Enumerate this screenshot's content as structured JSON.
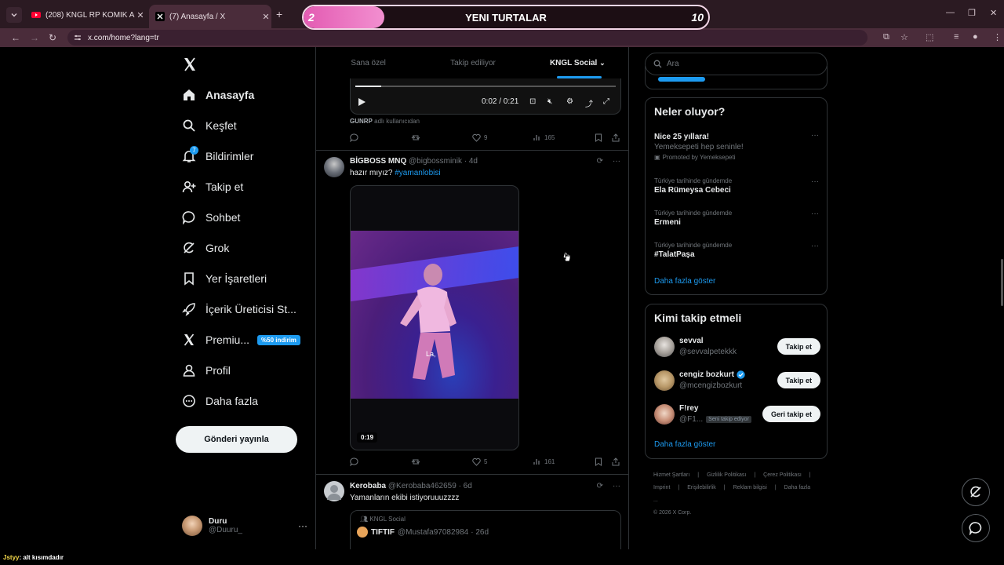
{
  "browser": {
    "tabs": [
      {
        "title": "(208) KNGL RP KOMİK ANLAR #",
        "icon": "youtube-icon"
      },
      {
        "title": "(7) Anasayfa / X",
        "icon": "x-icon"
      }
    ],
    "url": "x.com/home?lang=tr"
  },
  "overlay": {
    "left_value": "2",
    "title": "YENI TURTALAR",
    "right_value": "10",
    "progress": 0.2
  },
  "nav": {
    "items": [
      {
        "label": "Anasayfa",
        "icon": "home-icon"
      },
      {
        "label": "Keşfet",
        "icon": "search-icon"
      },
      {
        "label": "Bildirimler",
        "icon": "bell-icon",
        "badge": "7"
      },
      {
        "label": "Takip et",
        "icon": "follow-icon"
      },
      {
        "label": "Sohbet",
        "icon": "chat-icon"
      },
      {
        "label": "Grok",
        "icon": "grok-icon"
      },
      {
        "label": "Yer İşaretleri",
        "icon": "bookmark-icon"
      },
      {
        "label": "İçerik Üreticisi St...",
        "icon": "rocket-icon"
      },
      {
        "label": "Premiu...",
        "icon": "x-icon",
        "promo": "%50 indirim"
      },
      {
        "label": "Profil",
        "icon": "profile-icon"
      },
      {
        "label": "Daha fazla",
        "icon": "more-circle-icon"
      }
    ],
    "post_button": "Gönderi yayınla",
    "account": {
      "name": "Duru",
      "handle": "@Duuru_"
    }
  },
  "feed": {
    "tabs": [
      "Sana özel",
      "Takip ediliyor",
      "KNGL Social"
    ],
    "video_player": {
      "time": "0:02 / 0:21",
      "progress": 0.1
    },
    "source": {
      "user": "GUNRP",
      "text": "adlı kullanıcıdan"
    },
    "post1_actions": {
      "retweets": "",
      "likes": "9",
      "views": "165"
    },
    "post2": {
      "name": "BİGBOSS MNQ",
      "handle": "@bigbossminik",
      "time": "· 4d",
      "text": "hazır mıyız?",
      "hashtag": "#yamanlobisi",
      "caption": "La,",
      "duration": "0:19",
      "likes": "5",
      "views": "161"
    },
    "post3": {
      "name": "Kerobaba",
      "handle": "@Kerobaba462659",
      "time": "· 6d",
      "text": "Yamanların ekibi istiyoruuuzzzz",
      "quote": {
        "context": "KNGL Social",
        "name": "TIFTIF",
        "handle": "@Mustafa97082984",
        "time": "· 26d"
      }
    }
  },
  "right": {
    "search_placeholder": "Ara",
    "trends_title": "Neler oluyor?",
    "trends": [
      {
        "title": "Nice 25 yıllara!",
        "sub": "Yemeksepeti hep seninle!",
        "promo": "Promoted by Yemeksepeti"
      },
      {
        "context": "Türkiye tarihinde gündemde",
        "title": "Ela Rümeysa Cebeci"
      },
      {
        "context": "Türkiye tarihinde gündemde",
        "title": "Ermeni"
      },
      {
        "context": "Türkiye tarihinde gündemde",
        "title": "#TalatPaşa"
      }
    ],
    "show_more": "Daha fazla göster",
    "who_title": "Kimi takip etmeli",
    "who": [
      {
        "name": "sevval",
        "handle": "@sevvalpetekkk",
        "button": "Takip et"
      },
      {
        "name": "cengiz bozkurt",
        "handle": "@mcengizbozkurt",
        "button": "Takip et",
        "verified": true
      },
      {
        "name": "F!rey",
        "handle": "@F1...",
        "button": "Geri takip et",
        "follows_you": "Seni takip ediyor"
      }
    ],
    "who_show_more": "Daha fazla göster",
    "footer": [
      "Hizmet Şartları",
      "|",
      "Gizlilik Politikası",
      "|",
      "Çerez Politikası",
      "|",
      "Imprint",
      "|",
      "Erişilebilirlik",
      "|",
      "Reklam bilgisi",
      "|",
      "Daha fazla ...",
      "© 2026 X Corp."
    ]
  },
  "stream_chat": {
    "user": "Jstyy",
    "message": ": alt kısımdadır"
  },
  "colors": {
    "accent": "#1d9bf0",
    "background": "#000000",
    "browser": "#4a2c3a",
    "overlay_fill": "#e35bb2"
  }
}
